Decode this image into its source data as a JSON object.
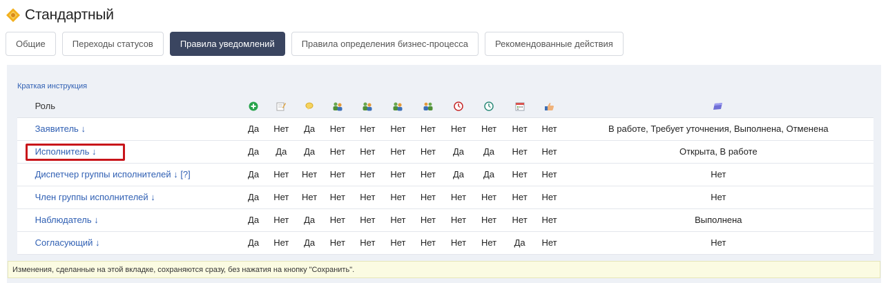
{
  "header": {
    "title": "Стандартный",
    "icon": "gear-diamond-icon"
  },
  "tabs": [
    {
      "label": "Общие",
      "active": false
    },
    {
      "label": "Переходы статусов",
      "active": false
    },
    {
      "label": "Правила уведомлений",
      "active": true
    },
    {
      "label": "Правила определения бизнес-процесса",
      "active": false
    },
    {
      "label": "Рекомендованные действия",
      "active": false
    }
  ],
  "instructions_link": "Краткая инструкция",
  "table": {
    "role_header": "Роль",
    "icon_columns": [
      "add-icon",
      "edit-icon",
      "comment-icon",
      "user-assign-icon",
      "user-assign-icon",
      "user-assign-icon",
      "group-icon",
      "overdue-clock-icon",
      "deadline-clock-icon",
      "calendar-icon",
      "approve-hand-icon",
      "status-flag-icon"
    ],
    "rows": [
      {
        "role": "Заявитель ↓",
        "values": [
          "Да",
          "Нет",
          "Да",
          "Нет",
          "Нет",
          "Нет",
          "Нет",
          "Нет",
          "Нет",
          "Нет",
          "Нет"
        ],
        "statuses": "В работе, Требует уточнения, Выполнена, Отменена"
      },
      {
        "role": "Исполнитель ↓",
        "values": [
          "Да",
          "Да",
          "Да",
          "Нет",
          "Нет",
          "Нет",
          "Нет",
          "Да",
          "Да",
          "Нет",
          "Нет"
        ],
        "statuses": "Открыта, В работе"
      },
      {
        "role": "Диспетчер группы исполнителей ↓ [?]",
        "values": [
          "Да",
          "Нет",
          "Нет",
          "Нет",
          "Нет",
          "Нет",
          "Нет",
          "Да",
          "Да",
          "Нет",
          "Нет"
        ],
        "statuses": "Нет"
      },
      {
        "role": "Член группы исполнителей ↓",
        "values": [
          "Да",
          "Нет",
          "Нет",
          "Нет",
          "Нет",
          "Нет",
          "Нет",
          "Нет",
          "Нет",
          "Нет",
          "Нет"
        ],
        "statuses": "Нет"
      },
      {
        "role": "Наблюдатель ↓",
        "values": [
          "Да",
          "Нет",
          "Да",
          "Нет",
          "Нет",
          "Нет",
          "Нет",
          "Нет",
          "Нет",
          "Нет",
          "Нет"
        ],
        "statuses": "Выполнена"
      },
      {
        "role": "Согласующий ↓",
        "values": [
          "Да",
          "Нет",
          "Да",
          "Нет",
          "Нет",
          "Нет",
          "Нет",
          "Нет",
          "Нет",
          "Да",
          "Нет"
        ],
        "statuses": "Нет"
      }
    ]
  },
  "notice": "Изменения, сделанные на этой вкладке, сохраняются сразу, без нажатия на кнопку \"Сохранить\".",
  "colors": {
    "tab_active": "#3a4560",
    "link": "#2f5fb3",
    "highlight": "#c8141a",
    "panel": "#eef1f6",
    "notice_bg": "#fbfbe2"
  }
}
